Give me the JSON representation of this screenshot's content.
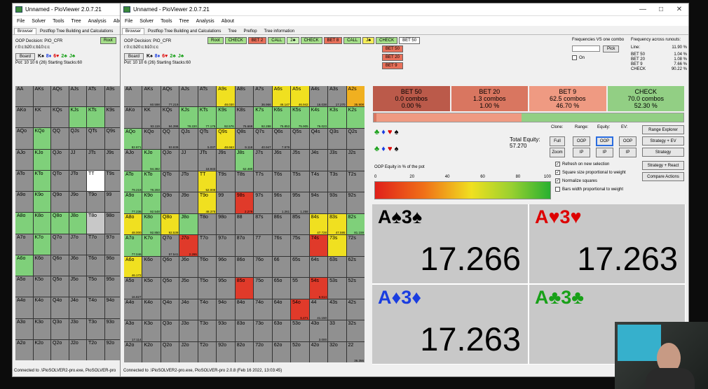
{
  "windows": {
    "back": {
      "title": "Unnamed - PioViewer 2.0.7.21",
      "status": "Connected to .\\PioSOLVER2-pro.exe, PioSOLVER-pro"
    },
    "front": {
      "title": "Unnamed - PioViewer 2.0.7.21",
      "status": "Connected to .\\PioSOLVER2-pro.exe, PioSOLVER-pro 2.0.8 (Feb 16 2022, 13:03:45)"
    }
  },
  "menu": [
    "File",
    "Solver",
    "Tools",
    "Tree",
    "Analysis",
    "About"
  ],
  "back_menu": [
    "File",
    "Solver",
    "Tools",
    "Tree",
    "Analysis",
    "Abo"
  ],
  "tabs": [
    "Browser",
    "Postflop Tree Building and Calculations",
    "Tree",
    "Preflop",
    "Tree information"
  ],
  "back_tabs": [
    "Browser",
    "Postflop Tree Building and Calculations",
    "Tree",
    "Abo"
  ],
  "decision": "OOP Decision: PIO_CFR",
  "line_code": "r:0:c:b20:c:b10:c:c",
  "board_label": "Board",
  "pot_info": "Pot: 10 10 6 (26) Starting Stacks:60",
  "board_cards": [
    {
      "t": "K♠",
      "c": "blk"
    },
    {
      "t": "8♦",
      "c": "blue"
    },
    {
      "t": "6♥",
      "c": "red"
    },
    {
      "t": "2♣",
      "c": "green"
    },
    {
      "t": "J♣",
      "c": "green"
    }
  ],
  "back_root": "Root",
  "tree_path": [
    {
      "t": "Root",
      "k": "n-root"
    },
    {
      "t": "CHECK",
      "k": "n-check"
    },
    {
      "t": "BET 2",
      "k": "n-bet"
    },
    {
      "t": "CALL",
      "k": "n-call"
    },
    {
      "t": "2♣",
      "k": "n-card"
    },
    {
      "t": "CHECK",
      "k": "n-check"
    },
    {
      "t": "BET 8",
      "k": "n-bet"
    },
    {
      "t": "CALL",
      "k": "n-call"
    },
    {
      "t": "J♣",
      "k": "n-j"
    },
    {
      "t": "CHECK",
      "k": "n-check"
    },
    {
      "t": "BET 50",
      "k": "n-sel"
    }
  ],
  "sub_nodes": [
    "BET 50",
    "BET 20",
    "BET 9"
  ],
  "freq_panel": {
    "title": "Frequencies VS one combo",
    "pick": "Pick",
    "on": "On"
  },
  "runouts": {
    "title": "Frequency across runouts:",
    "line_label": "Line:",
    "line_val": "11.90 %",
    "rows": [
      {
        "k": "BET 50",
        "v": "1.04 %"
      },
      {
        "k": "BET 20",
        "v": "1.08 %"
      },
      {
        "k": "BET 9",
        "v": "7.66 %"
      },
      {
        "k": "CHECK",
        "v": "90.22 %"
      }
    ]
  },
  "actions": [
    {
      "name": "BET 50",
      "combos": "0.0 combos",
      "pct": "0.00 %",
      "color": "#bb5a4a"
    },
    {
      "name": "BET 20",
      "combos": "1.3 combos",
      "pct": "1.00 %",
      "color": "#d97660"
    },
    {
      "name": "BET 9",
      "combos": "62.5 combos",
      "pct": "46.70 %",
      "color": "#ef9a82"
    },
    {
      "name": "CHECK",
      "combos": "70.0 combos",
      "pct": "52.30 %",
      "color": "#92cf84"
    }
  ],
  "action_bar": [
    0.0,
    1.0,
    46.7,
    52.3
  ],
  "total_equity_label": "Total Equity:",
  "total_equity": "57.270",
  "controls": {
    "clone": "Clone:",
    "range": "Range:",
    "equity": "Equity:",
    "ev": "EV:",
    "full": "Full",
    "zoom": "Zoom",
    "oop": "OOP",
    "ip": "IP",
    "range_explorer": "Range Explorer",
    "strategy_ev": "Strategy + EV",
    "strategy": "Strategy",
    "strategy_react": "Strategy + React",
    "compare": "Compare Actions"
  },
  "checkboxes": [
    {
      "label": "Refresh on new selection",
      "checked": true
    },
    {
      "label": "Square size proportional to weight",
      "checked": true
    },
    {
      "label": "Normalize squares",
      "checked": true
    },
    {
      "label": "Bars width proportional to weight",
      "checked": false
    }
  ],
  "equity_title": "OOP Equity in % of the pot",
  "scale": [
    "0",
    "20",
    "40",
    "60",
    "80",
    "100"
  ],
  "combos": [
    {
      "hand": [
        {
          "t": "A♠",
          "c": "blk"
        },
        {
          "t": "3♠",
          "c": "blk"
        }
      ],
      "eq": "17.266"
    },
    {
      "hand": [
        {
          "t": "A♥",
          "c": "red"
        },
        {
          "t": "3♥",
          "c": "red"
        }
      ],
      "eq": "17.263"
    },
    {
      "hand": [
        {
          "t": "A♦",
          "c": "blue"
        },
        {
          "t": "3♦",
          "c": "blue"
        }
      ],
      "eq": "17.263"
    },
    {
      "hand": [
        {
          "t": "A♣",
          "c": "green"
        },
        {
          "t": "3♣",
          "c": "green"
        }
      ],
      "eq": "17."
    }
  ],
  "ranks": [
    "A",
    "K",
    "Q",
    "J",
    "T",
    "9",
    "8",
    "7",
    "6",
    "5",
    "4",
    "3",
    "2"
  ],
  "grid_freq": {
    "AA": "",
    "AKs": "60.598",
    "AQs": "77.219",
    "AJs": "",
    "ATs": "",
    "A9s": "48.030",
    "A8s": "",
    "A7s": "36.966",
    "A6s": "46.147",
    "A5s": "46.942",
    "A4s": "16.038",
    "A3s": "17.270",
    "A2s": "35.908",
    "KK": "93.119",
    "KQs": "94.398",
    "KJs": "78.220",
    "KTs": "77.175",
    "K9s": "92.576",
    "K8s": "76.669",
    "K7s": "92.288",
    "K6s": "75.853",
    "K5s": "75.905",
    "K4s": "76.023",
    "K3s": "",
    "K2s": "",
    "AKo": "",
    "KQo": "",
    "QQ": "93.839",
    "QJs": "",
    "QTs": "5.037",
    "Q9s": "48.663",
    "Q8s": "9.118",
    "Q7s": "40.947",
    "Q6s": "7.979",
    "Q5s": "",
    "Q4s": "",
    "Q3s": "",
    "Q2s": "",
    "AQo": "82.871",
    "KJo": "94.382",
    "JJ": "",
    "JTs": "18.933",
    "J9s": "",
    "J8s": "62.480",
    "J7s": "",
    "J6s": "",
    "J5s": "",
    "J4s": "",
    "J3s": "",
    "J2s": "",
    "ATo": "79.219",
    "KTo": "78.203",
    "QTo": "",
    "TT": "52.008",
    "T9s": "",
    "T8s": "",
    "T7s": "",
    "T6s": "",
    "T5s": "",
    "T4s": "",
    "T3s": "",
    "T2s": "",
    "A9o": "77.236",
    "K9o": "92.548",
    "Q9o": "",
    "J9o": "",
    "T9o": "48.375",
    "99": "",
    "98s": "2.279",
    "97s": "",
    "96s": "1.261",
    "95s": "1.258",
    "94s": "",
    "93s": "",
    "92s": "",
    "A8o": "48.000",
    "K8o": "92.850",
    "Q8o": "92.539",
    "J8o": "",
    "T8o": "",
    "98o": "",
    "88": "",
    "87s": "",
    "86s": "",
    "85s": "",
    "84s": "47.728",
    "83s": "47.595",
    "82s": "81.159",
    "A7o": "77.046",
    "K7o": "",
    "Q7o": "57.541",
    "J7o": "2.265",
    "T7o": "",
    "97o": "",
    "87o": "",
    "77": "",
    "76s": "",
    "75s": "",
    "74s": "",
    "73s": "",
    "72s": "",
    "A6o": "46.172",
    "K6o": "",
    "Q6o": "",
    "J6o": "",
    "T6o": "",
    "96o": "",
    "86o": "",
    "76o": "",
    "66": "",
    "65s": "",
    "64s": "",
    "63s": "",
    "62s": "",
    "A5o": "16.827",
    "K5o": "",
    "Q5o": "",
    "J5o": "",
    "T5o": "",
    "95o": "",
    "85o": "",
    "75o": "",
    "65o": "",
    "55": "",
    "54s": "6.614",
    "53s": "",
    "52s": "",
    "A4o": "",
    "K4o": "",
    "Q4o": "",
    "J4o": "",
    "T4o": "",
    "94o": "",
    "84o": "",
    "74o": "",
    "64o": "",
    "54o": "6.471",
    "44": "41.150",
    "43s": "",
    "42s": "",
    "A3o": "17.114",
    "K3o": "",
    "Q3o": "",
    "J3o": "",
    "T3o": "",
    "93o": "",
    "83o": "",
    "73o": "",
    "63o": "",
    "53o": "",
    "43o": "3.000",
    "33": "",
    "32s": "",
    "A2o": "",
    "K2o": "",
    "Q2o": "",
    "J2o": "",
    "T2o": "",
    "92o": "",
    "82o": "",
    "72o": "",
    "62o": "",
    "52o": "",
    "42o": "",
    "32o": "",
    "22": "36.356"
  },
  "grid_colors": {
    "AKs": "#909090",
    "A9s": "#f0e020",
    "A6s": "#f0e020",
    "A5s": "#f0e020",
    "A2s": "#f0b020",
    "A3s": "#909090",
    "A7s": "#909090",
    "A4s": "#909090",
    "AQs": "#909090",
    "KK": "#909090",
    "KQs": "#909090",
    "KJs": "#7fd07a",
    "KTs": "#7fd07a",
    "K9s": "#7fd07a",
    "K8s": "#909090",
    "K7s": "#7fd07a",
    "K6s": "#7fd07a",
    "K5s": "#7fd07a",
    "K4s": "#7fd07a",
    "K3s": "#7fd07a",
    "K2s": "#7fd07a",
    "AKo": "#909090",
    "QQ": "#909090",
    "QJs": "#909090",
    "QTs": "#909090",
    "Q9s": "#f0e020",
    "Q8s": "#909090",
    "Q7s": "#909090",
    "Q6s": "#909090",
    "Q5s": "#909090",
    "Q4s": "#909090",
    "Q3s": "#909090",
    "Q2s": "#909090",
    "AQo": "#7fd07a",
    "KQo": "#909090",
    "KJo": "#7fd07a",
    "JJ": "#909090",
    "JTs": "#909090",
    "J9s": "#909090",
    "J8s": "#7fd07a",
    "J7s": "#909090",
    "J6s": "#909090",
    "J5s": "#909090",
    "J4s": "#909090",
    "J3s": "#909090",
    "J2s": "#909090",
    "ATo": "#7fd07a",
    "KTo": "#7fd07a",
    "QTo": "#909090",
    "TT": "#f0e020",
    "T9s": "#909090",
    "T8s": "#909090",
    "T7s": "#909090",
    "T6s": "#909090",
    "T5s": "#909090",
    "T4s": "#909090",
    "T3s": "#909090",
    "T2s": "#909090",
    "A9o": "#7fd07a",
    "K9o": "#7fd07a",
    "Q9o": "#909090",
    "J9o": "#909090",
    "T9o": "#f0e020",
    "99": "#909090",
    "98s": "#e03a2a",
    "97s": "#909090",
    "96s": "#909090",
    "95s": "#909090",
    "94s": "#909090",
    "93s": "#909090",
    "92s": "#909090",
    "A8o": "#f0e020",
    "K8o": "#7fd07a",
    "Q8o": "#f0e020",
    "J8o": "#7fd07a",
    "T8o": "#909090",
    "98o": "#909090",
    "88": "#909090",
    "87s": "#909090",
    "86s": "#909090",
    "85s": "#909090",
    "84s": "#f0e020",
    "83s": "#f0e020",
    "82s": "#7fd07a",
    "A7o": "#7fd07a",
    "K7o": "#7fd07a",
    "Q7o": "#909090",
    "J7o": "#e03a2a",
    "T7o": "#909090",
    "97o": "#909090",
    "87o": "#909090",
    "77": "#909090",
    "76s": "#909090",
    "75s": "#909090",
    "74s": "#e03a2a",
    "73s": "#f0e020",
    "72s": "#909090",
    "A6o": "#f0e020",
    "K6o": "#909090",
    "Q6o": "#909090",
    "J6o": "#909090",
    "T6o": "#909090",
    "96o": "#909090",
    "86o": "#909090",
    "76o": "#909090",
    "66": "#909090",
    "65s": "#909090",
    "64s": "#909090",
    "63s": "#909090",
    "62s": "#909090",
    "A5o": "#909090",
    "K5o": "#909090",
    "Q5o": "#909090",
    "J5o": "#909090",
    "T5o": "#909090",
    "95o": "#909090",
    "85o": "#e03a2a",
    "75o": "#909090",
    "65o": "#909090",
    "55": "#909090",
    "54s": "#e03a2a",
    "53s": "#909090",
    "52s": "#909090",
    "A4o": "#909090",
    "K4o": "#909090",
    "Q4o": "#909090",
    "J4o": "#909090",
    "T4o": "#909090",
    "94o": "#909090",
    "84o": "#909090",
    "74o": "#909090",
    "64o": "#909090",
    "54o": "#e03a2a",
    "44": "#909090",
    "43s": "#909090",
    "42s": "#909090",
    "A3o": "#909090",
    "K3o": "#909090",
    "Q3o": "#909090",
    "J3o": "#909090",
    "T3o": "#909090",
    "93o": "#909090",
    "83o": "#909090",
    "73o": "#909090",
    "63o": "#909090",
    "53o": "#909090",
    "43o": "#909090",
    "33": "#909090",
    "32s": "#909090",
    "A2o": "#909090",
    "K2o": "#909090",
    "Q2o": "#909090",
    "J2o": "#909090",
    "T2o": "#909090",
    "92o": "#909090",
    "82o": "#909090",
    "72o": "#909090",
    "62o": "#909090",
    "52o": "#909090",
    "42o": "#909090",
    "32o": "#909090",
    "22": "#909090"
  },
  "back_colors": {
    "KTs": "#7fd07a",
    "AKo": "#909090",
    "KQo": "#7fd07a",
    "KJs": "#7fd07a",
    "AQo": "#909090",
    "KJo": "#7fd07a",
    "ATo": "#909090",
    "KTo": "#7fd07a",
    "TT": "#ffffff",
    "K9o": "#7fd07a",
    "A8o": "#7fd07a",
    "K8o": "#7fd07a",
    "Q8o": "#7fd07a",
    "J8o": "#7fd07a",
    "A7o": "#909090",
    "K7o": "#7fd07a",
    "A6o": "#7fd07a",
    "T8o": "#c8c8c8"
  }
}
